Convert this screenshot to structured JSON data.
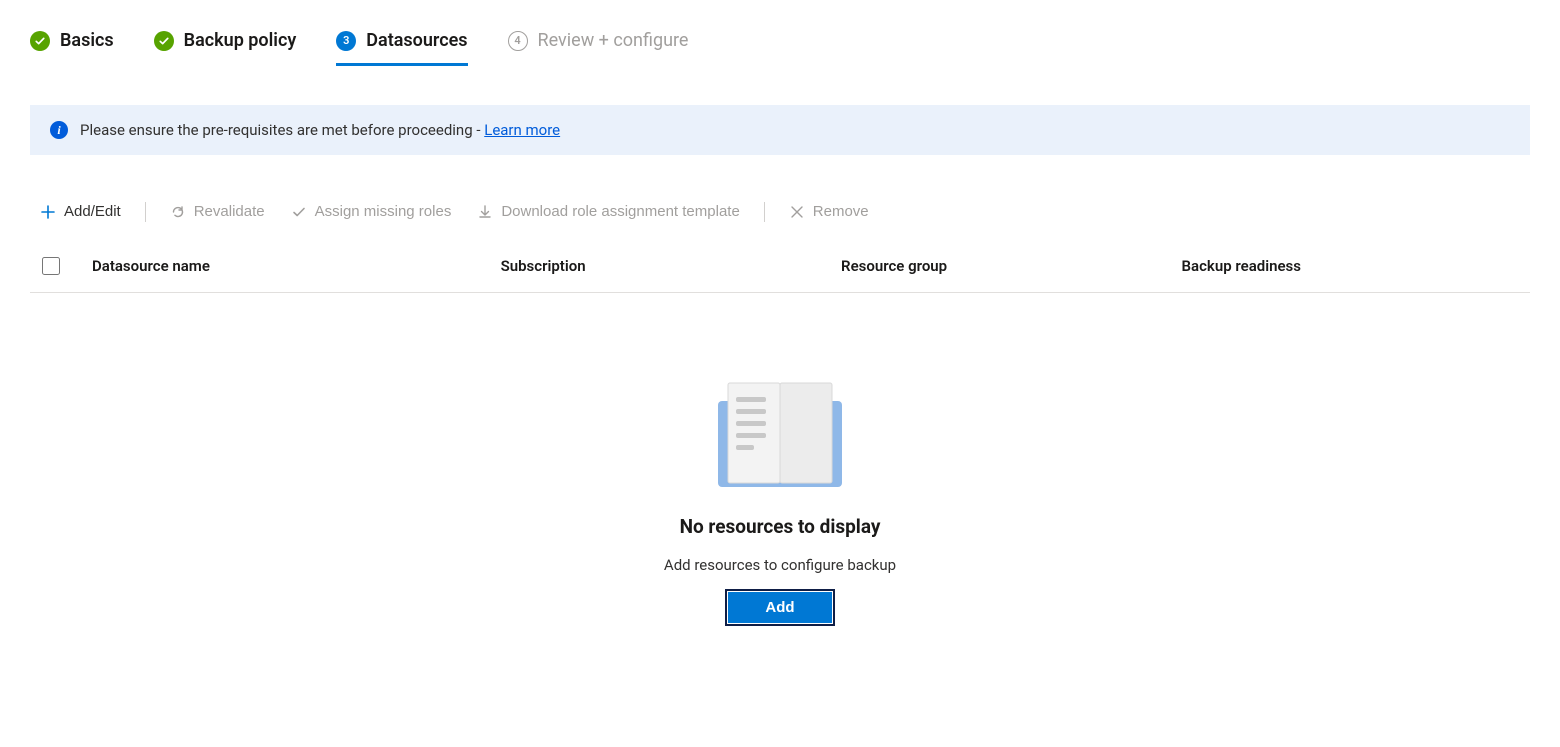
{
  "stepper": {
    "steps": [
      {
        "label": "Basics",
        "state": "done"
      },
      {
        "label": "Backup policy",
        "state": "done"
      },
      {
        "label": "Datasources",
        "state": "active",
        "number": "3"
      },
      {
        "label": "Review + configure",
        "state": "upcoming",
        "number": "4"
      }
    ]
  },
  "info_banner": {
    "text": "Please ensure the pre-requisites are met before proceeding - ",
    "link_label": "Learn more"
  },
  "toolbar": {
    "add_edit": "Add/Edit",
    "revalidate": "Revalidate",
    "assign": "Assign missing roles",
    "download": "Download role assignment template",
    "remove": "Remove"
  },
  "table": {
    "columns": {
      "name": "Datasource name",
      "subscription": "Subscription",
      "rg": "Resource group",
      "readiness": "Backup readiness"
    }
  },
  "empty_state": {
    "title": "No resources to display",
    "subtitle": "Add resources to configure backup",
    "button": "Add"
  }
}
